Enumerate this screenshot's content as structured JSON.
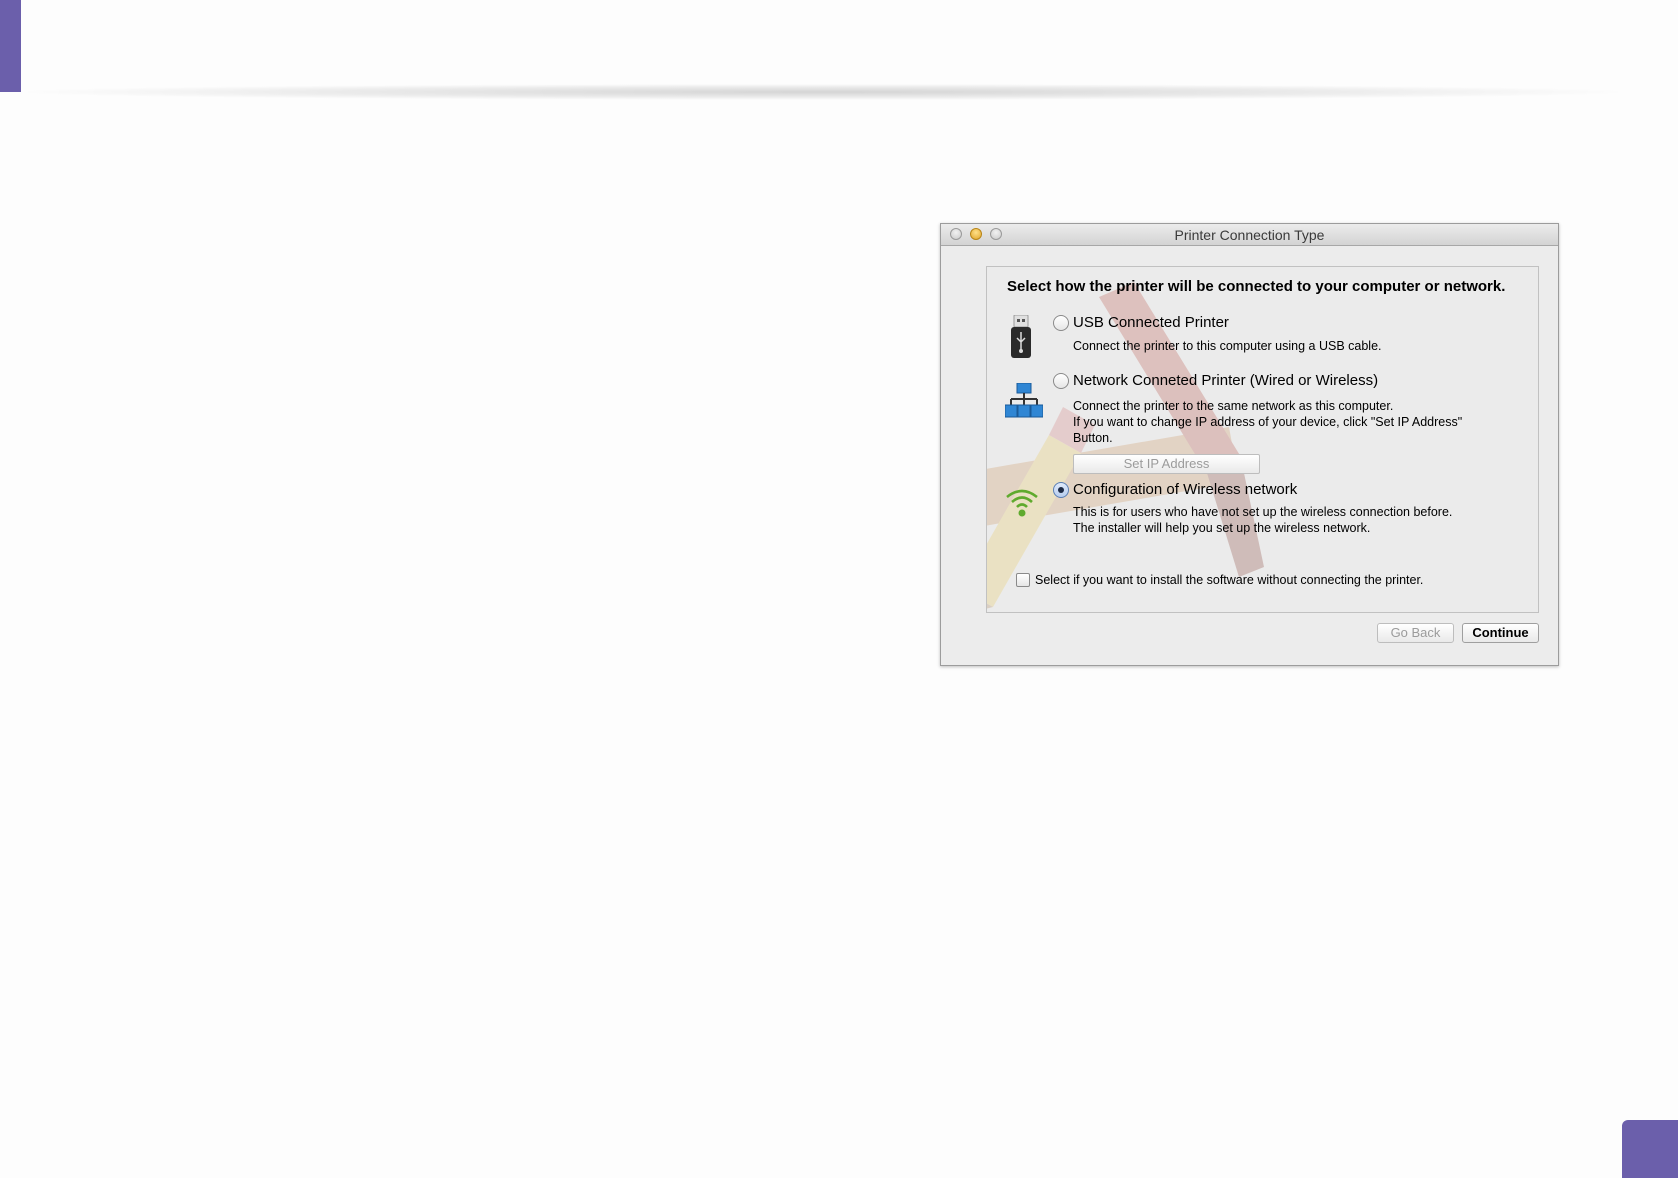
{
  "window": {
    "title": "Printer Connection Type"
  },
  "panel": {
    "heading": "Select how the printer will be connected to your computer or network."
  },
  "options": [
    {
      "label": "USB Connected Printer",
      "selected": false,
      "icon": "usb-icon",
      "description": [
        "Connect the printer to this computer using a USB cable."
      ]
    },
    {
      "label": "Network Conneted Printer (Wired or Wireless)",
      "selected": false,
      "icon": "network-icon",
      "description": [
        "Connect the printer to the same network as this computer.",
        "If you want to change IP address of your device, click \"Set IP Address\"",
        "Button."
      ],
      "button_label": "Set IP Address",
      "button_enabled": false
    },
    {
      "label": "Configuration of Wireless network",
      "selected": true,
      "icon": "wifi-icon",
      "description": [
        "This is for users who have not set up the wireless connection before.",
        "The installer will help you set up the wireless network."
      ]
    }
  ],
  "install_without_connecting": {
    "label": "Select if you want to install the software without connecting the printer.",
    "checked": false
  },
  "footer": {
    "go_back_label": "Go Back",
    "go_back_enabled": false,
    "continue_label": "Continue"
  },
  "colors": {
    "accent": "#6b5fab",
    "wifi": "#5faa2e",
    "network": "#2f86d4"
  }
}
